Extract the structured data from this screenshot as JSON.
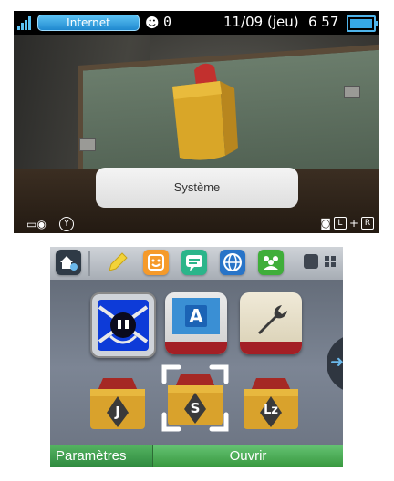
{
  "status_bar": {
    "connection": "Internet",
    "friend_count": "0",
    "date": "11/09 (jeu)",
    "time": "6 57"
  },
  "top_screen": {
    "tooltip": "Système",
    "left_key": "Y",
    "right_keys": [
      "L",
      "+",
      "R"
    ]
  },
  "bottom_screen": {
    "toolbar": [
      {
        "icon": "home-settings-icon"
      },
      {
        "icon": "pencil-icon"
      },
      {
        "icon": "smiley-icon"
      },
      {
        "icon": "chat-bubble-icon"
      },
      {
        "icon": "globe-icon"
      },
      {
        "icon": "friends-icon"
      },
      {
        "icon": "single-view-icon"
      },
      {
        "icon": "grid-view-icon"
      }
    ],
    "apps_row1": [
      {
        "icon": "swordsman-app-icon"
      },
      {
        "icon": "letter-a-app-icon",
        "letter": "A"
      },
      {
        "icon": "wrench-app-icon"
      }
    ],
    "apps_row2": [
      {
        "icon": "folder-j-icon",
        "letter": "J"
      },
      {
        "icon": "folder-s-icon",
        "letter": "S"
      },
      {
        "icon": "folder-lz-icon",
        "letter": "Lz"
      }
    ],
    "footer_label": "Paramètres",
    "footer_button": "Ouvrir"
  }
}
